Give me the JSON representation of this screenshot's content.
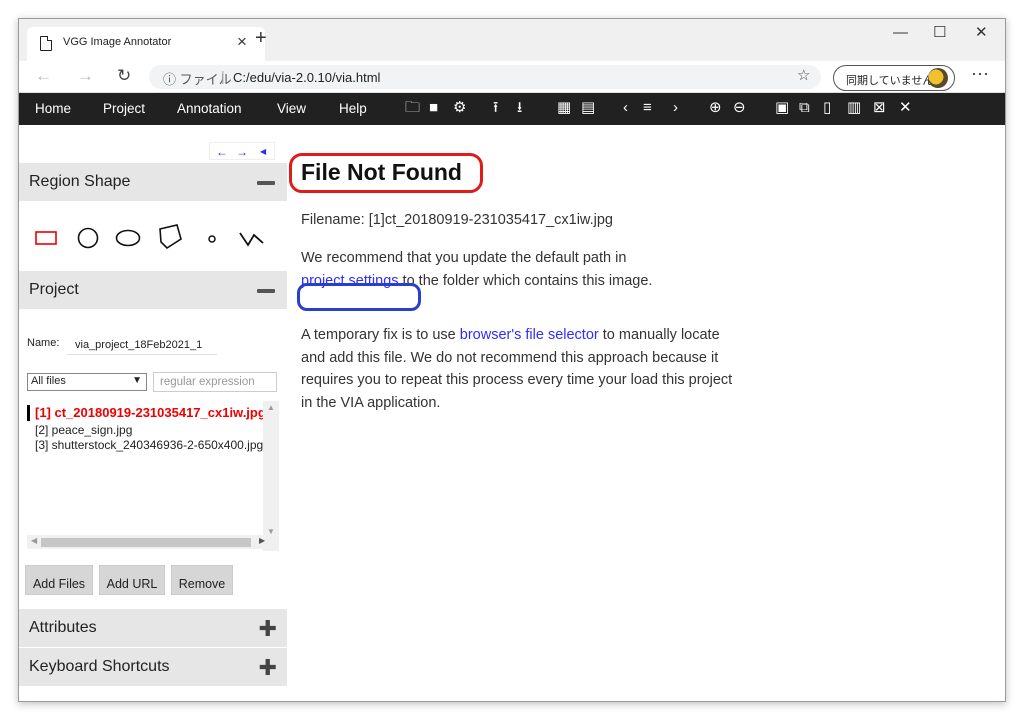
{
  "browser": {
    "tab_title": "VGG Image Annotator",
    "tab_close": "×",
    "new_tab": "+",
    "url_info": "ⓘ ファイル",
    "url_sep": "|",
    "url": "C:/edu/via-2.0.10/via.html",
    "sync_label": "同期していません",
    "more": "···",
    "win_min": "—",
    "win_max": "☐",
    "win_close": "✕"
  },
  "menu": {
    "home": "Home",
    "project": "Project",
    "annotation": "Annotation",
    "view": "View",
    "help": "Help"
  },
  "left": {
    "region_shape_title": "Region Shape",
    "project_title": "Project",
    "name_label": "Name:",
    "project_name": "via_project_18Feb2021_1",
    "file_filter": "All files",
    "regex_placeholder": "regular expression",
    "files": [
      "[1] ct_20180919-231035417_cx1iw.jpg",
      "[2] peace_sign.jpg",
      "[3] shutterstock_240346936-2-650x400.jpg"
    ],
    "add_files": "Add Files",
    "add_url": "Add URL",
    "remove": "Remove",
    "attributes_title": "Attributes",
    "shortcuts_title": "Keyboard Shortcuts"
  },
  "main": {
    "title": "File Not Found",
    "filename_line": "Filename: [1]ct_20180919-231035417_cx1iw.jpg",
    "rec_1": "We recommend that you update the default path in",
    "rec_link": "project settings",
    "rec_2": " to the folder which contains this image.",
    "tmp_1": "A temporary fix is to use ",
    "tmp_link": "browser's file selector",
    "tmp_2": " to manually locate and add this file. We do not recommend this approach because it requires you to repeat this process every time your load this project in the VIA application."
  },
  "colors": {
    "menu_bg": "#212121",
    "active_file": "#ee0000",
    "link": "#2d2dff",
    "highlight_red": "#e01b1b",
    "highlight_blue": "#2b3fce"
  }
}
